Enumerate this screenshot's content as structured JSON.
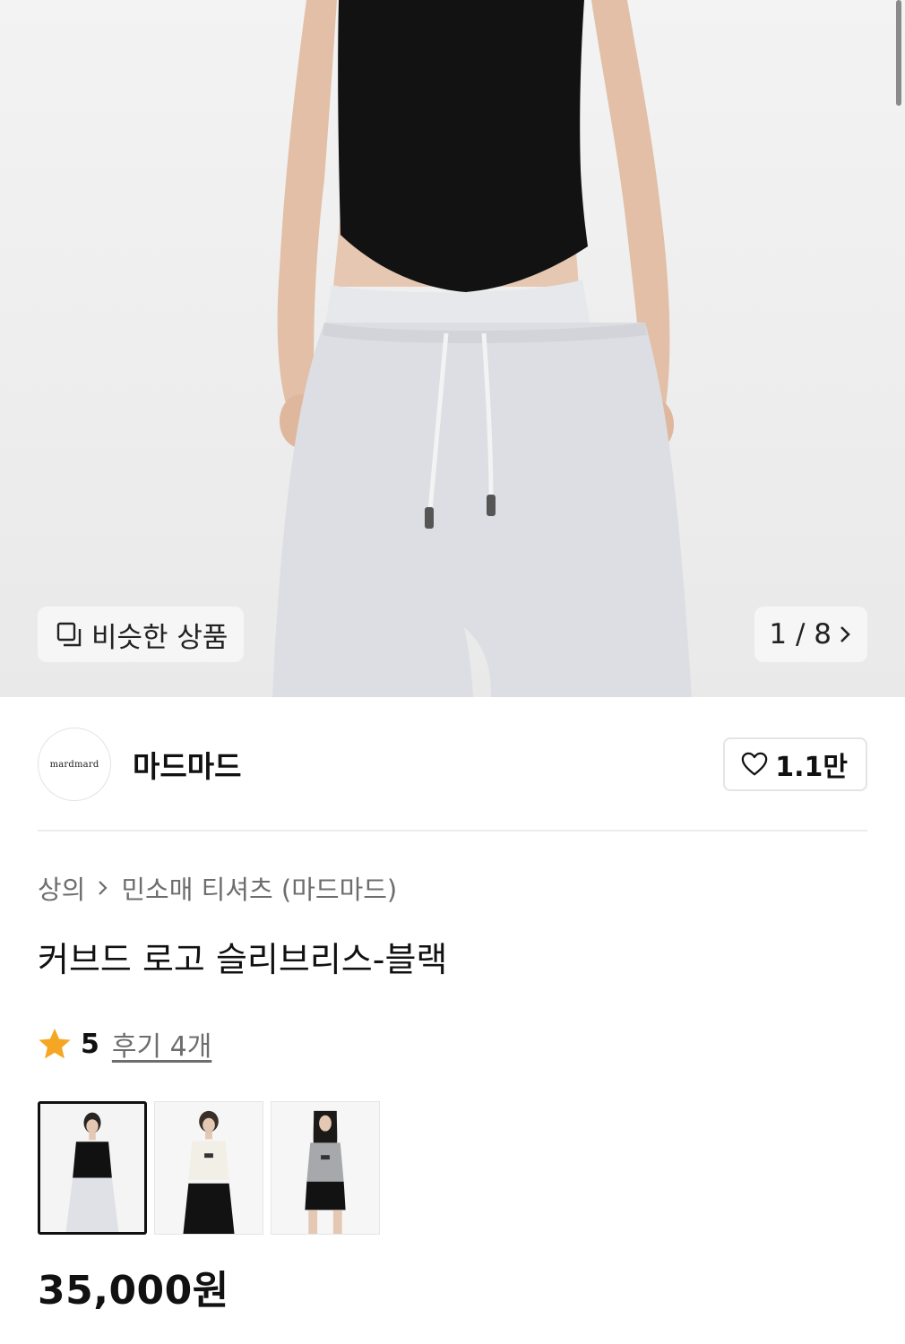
{
  "hero": {
    "similar_label": "비슷한 상품",
    "page_counter": "1 / 8",
    "similar_icon": "duplicate-icon",
    "next_icon": "chevron-right-icon"
  },
  "brand": {
    "logo_text": "mardmard",
    "name": "마드마드",
    "like_count": "1.1만",
    "like_icon": "heart-outline-icon"
  },
  "breadcrumb": {
    "category": "상의",
    "subcategory": "민소매 티셔츠 (마드마드)"
  },
  "product": {
    "title": "커브드 로고 슬리브리스-블랙",
    "rating": "5",
    "reviews": "후기 4개",
    "price": "35,000원"
  },
  "colors": {
    "star": "#F5A623",
    "text_primary": "#111111",
    "text_secondary": "#6D6D6D"
  },
  "color_options": [
    {
      "name": "black-option",
      "selected": true
    },
    {
      "name": "ivory-option",
      "selected": false
    },
    {
      "name": "gray-option",
      "selected": false
    }
  ]
}
